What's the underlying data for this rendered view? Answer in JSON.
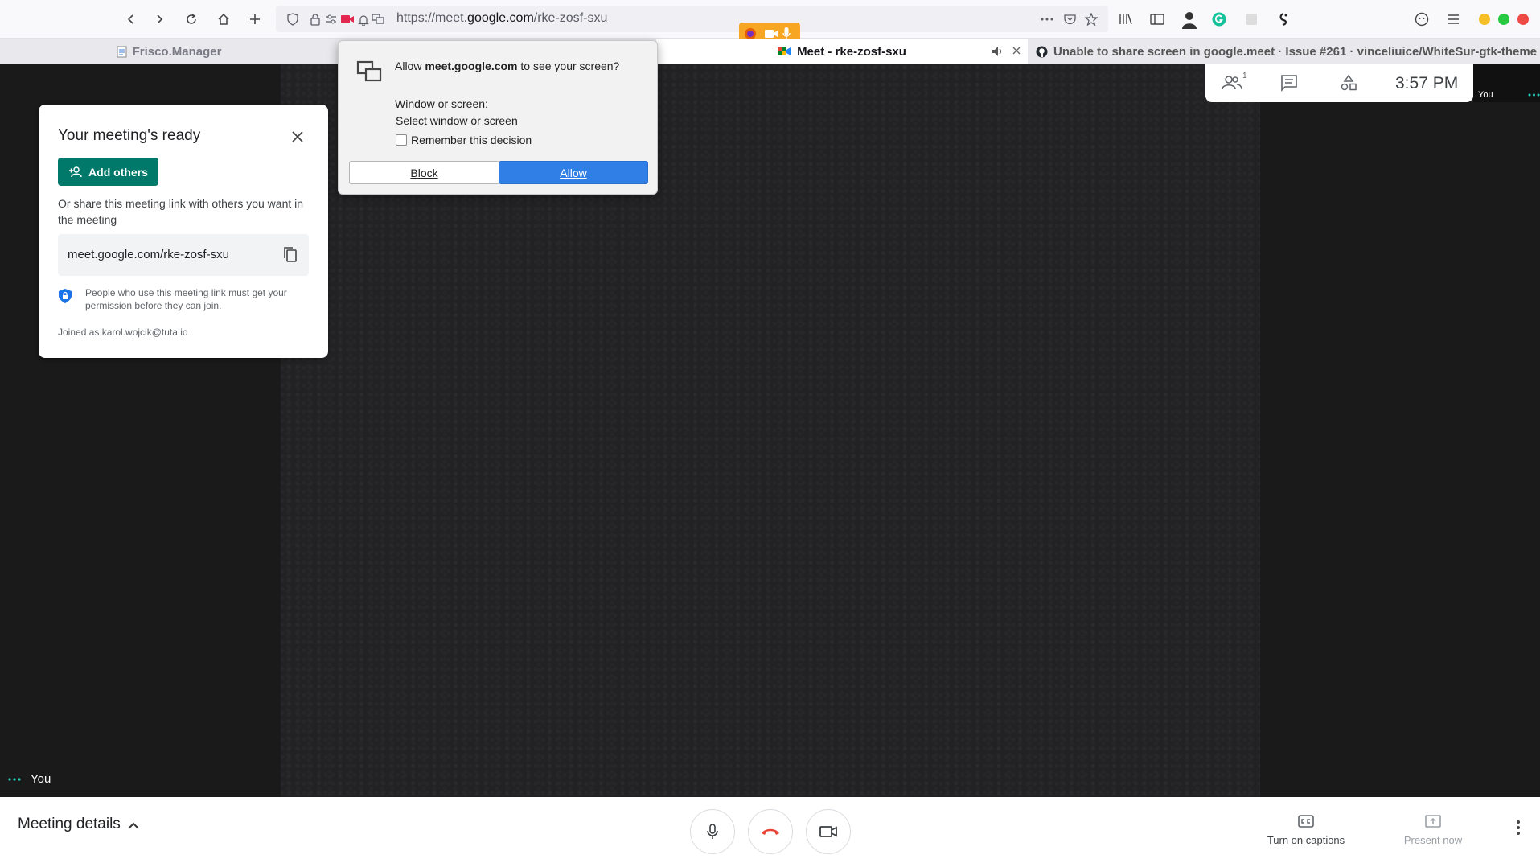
{
  "browser": {
    "url_prefix": "https://meet.",
    "url_domain": "google.com",
    "url_path": "/rke-zosf-sxu",
    "window_controls": {
      "minimize": "#f5bd26",
      "maximize": "#28c840",
      "close": "#ec4c43"
    }
  },
  "tabs": [
    {
      "title": "Frisco.Manager",
      "active": false
    },
    {
      "title": "Meet - rke-zosf-sxu",
      "active": true
    },
    {
      "title": "Unable to share screen in google.meet · Issue #261 · vinceliuice/WhiteSur-gtk-theme",
      "active": false
    }
  ],
  "permission_popup": {
    "question_prefix": "Allow ",
    "question_domain": "meet.google.com",
    "question_suffix": " to see your screen?",
    "window_label": "Window or screen:",
    "window_select": "Select window or screen",
    "remember_label": "Remember this decision",
    "block_label": "Block",
    "allow_label": "Allow"
  },
  "ready_card": {
    "title": "Your meeting's ready",
    "add_others_label": "Add others",
    "share_text": "Or share this meeting link with others you want in the meeting",
    "meeting_link": "meet.google.com/rke-zosf-sxu",
    "permission_note": "People who use this meeting link must get your permission before they can join.",
    "joined_as": "Joined as karol.wojcik@tuta.io"
  },
  "info_panel": {
    "participants_count": "1",
    "time": "3:57 PM",
    "self_label": "You"
  },
  "stage": {
    "self_name": "You"
  },
  "bottom_bar": {
    "meeting_details_label": "Meeting details",
    "captions_label": "Turn on captions",
    "present_label": "Present now"
  },
  "colors": {
    "accent_teal": "#00796b",
    "hangup_red": "#ea4335",
    "allow_blue": "#2f7fe6",
    "share_indicator": "#f6a623"
  }
}
